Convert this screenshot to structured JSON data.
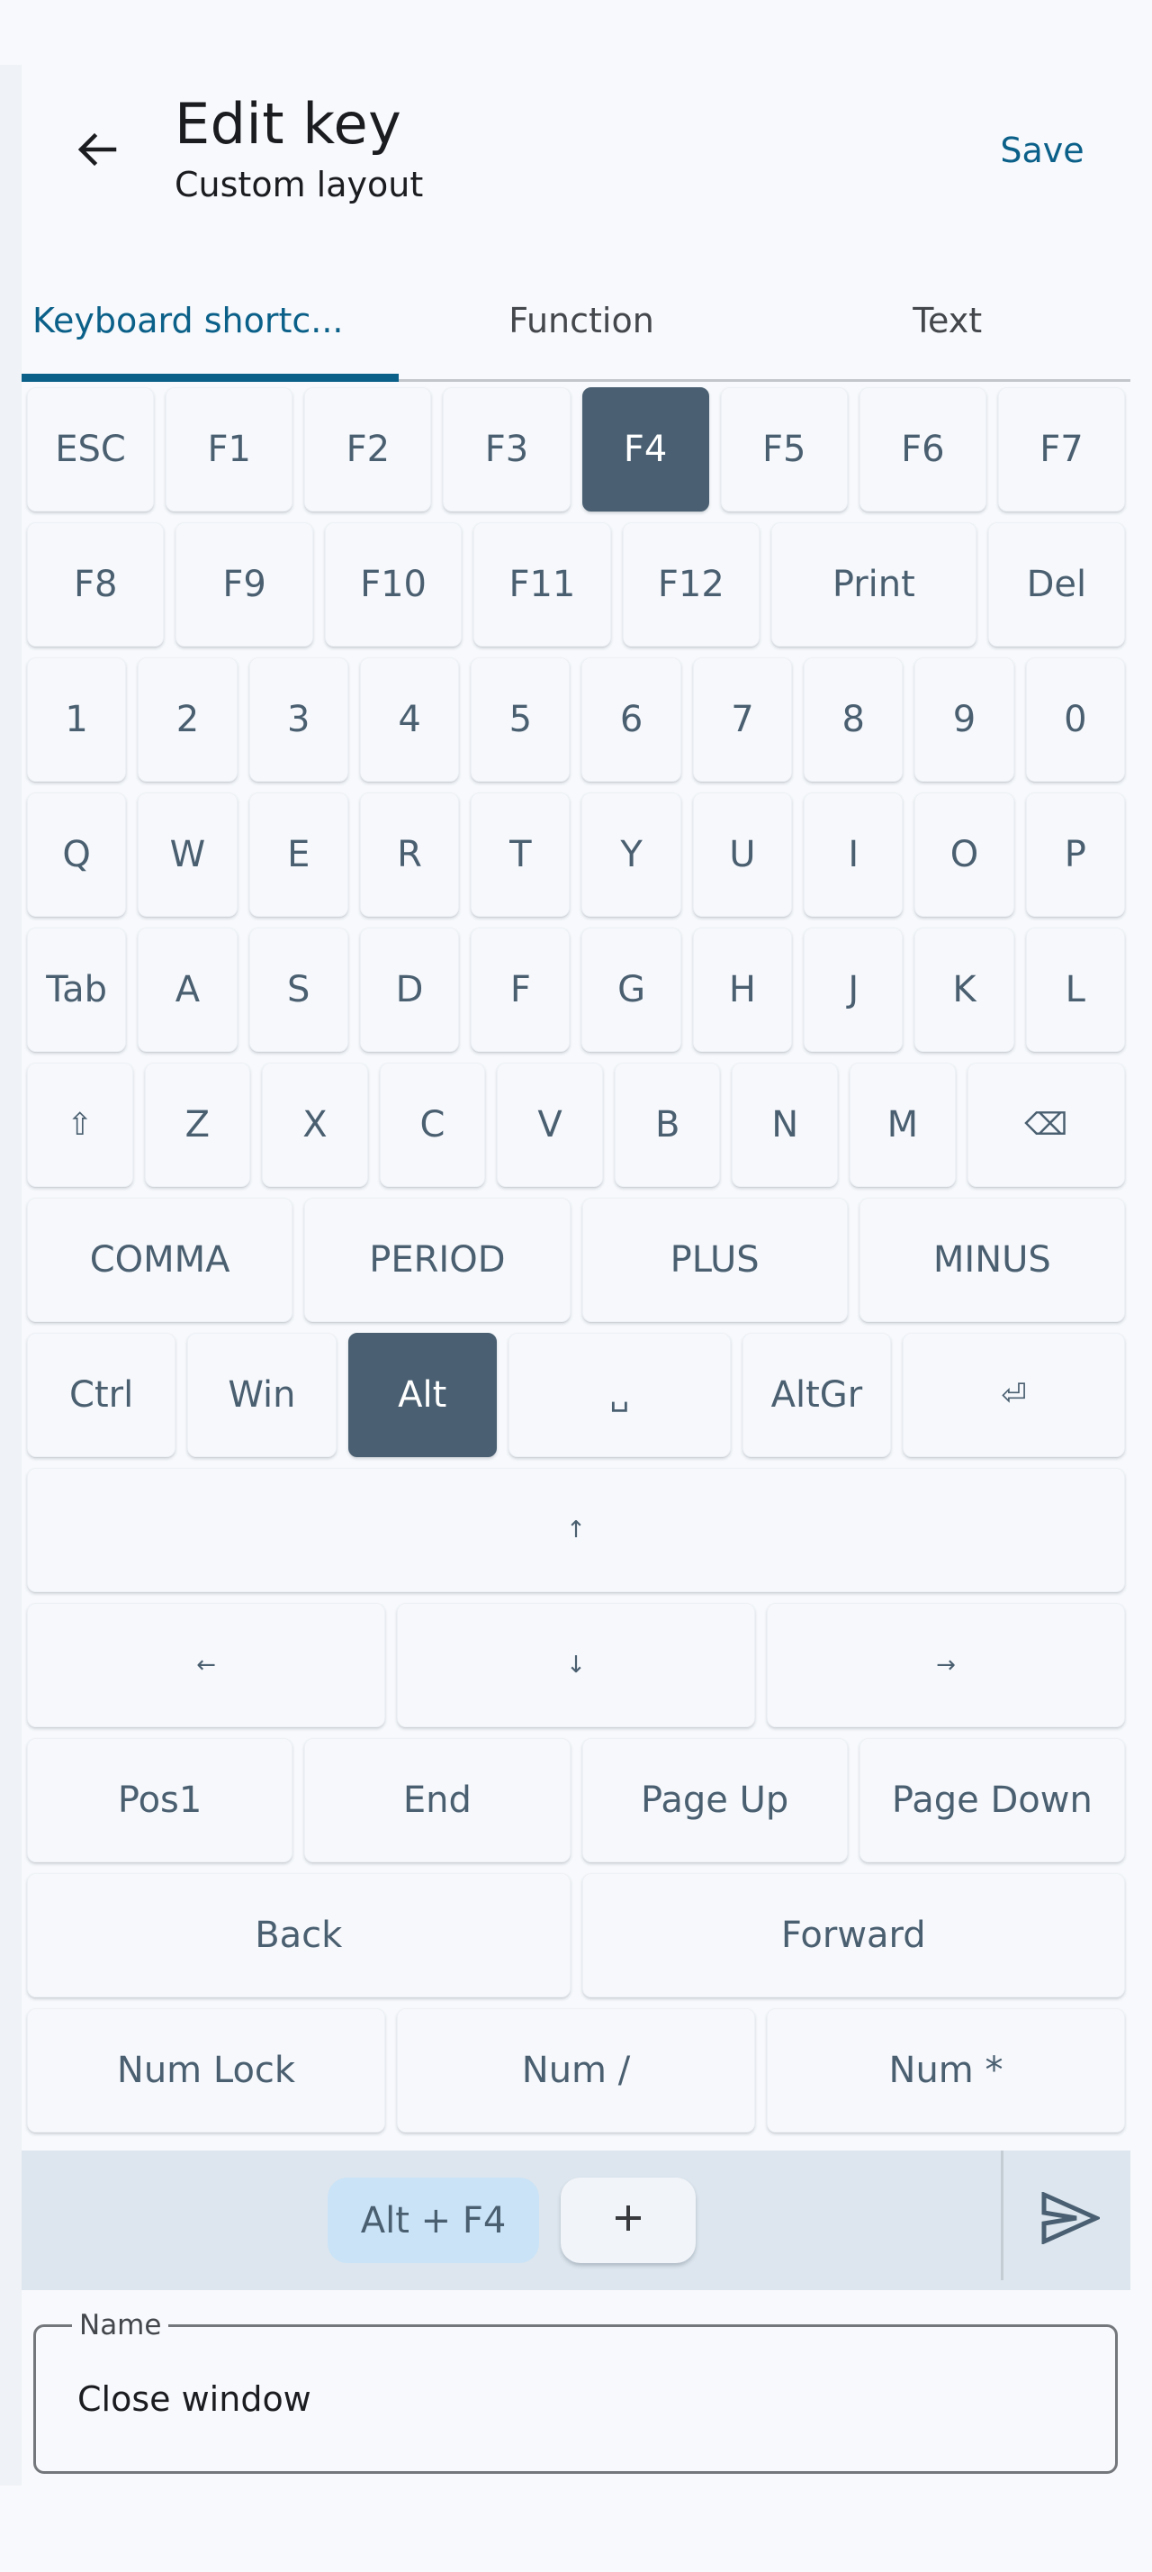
{
  "header": {
    "back_icon": "arrow-left-icon",
    "title": "Edit key",
    "subtitle": "Custom layout",
    "save_label": "Save"
  },
  "tabs": [
    {
      "label": "Keyboard shortc...",
      "active": true
    },
    {
      "label": "Function",
      "active": false
    },
    {
      "label": "Text",
      "active": false
    }
  ],
  "keyboard": {
    "rows": [
      [
        {
          "label": "ESC"
        },
        {
          "label": "F1"
        },
        {
          "label": "F2"
        },
        {
          "label": "F3"
        },
        {
          "label": "F4",
          "selected": true
        },
        {
          "label": "F5"
        },
        {
          "label": "F6"
        },
        {
          "label": "F7"
        }
      ],
      [
        {
          "label": "F8"
        },
        {
          "label": "F9"
        },
        {
          "label": "F10"
        },
        {
          "label": "F11"
        },
        {
          "label": "F12"
        },
        {
          "label": "Print",
          "wide": true
        },
        {
          "label": "Del"
        }
      ],
      [
        {
          "label": "1"
        },
        {
          "label": "2"
        },
        {
          "label": "3"
        },
        {
          "label": "4"
        },
        {
          "label": "5"
        },
        {
          "label": "6"
        },
        {
          "label": "7"
        },
        {
          "label": "8"
        },
        {
          "label": "9"
        },
        {
          "label": "0"
        }
      ],
      [
        {
          "label": "Q"
        },
        {
          "label": "W"
        },
        {
          "label": "E"
        },
        {
          "label": "R"
        },
        {
          "label": "T"
        },
        {
          "label": "Y"
        },
        {
          "label": "U"
        },
        {
          "label": "I"
        },
        {
          "label": "O"
        },
        {
          "label": "P"
        }
      ],
      [
        {
          "label": "Tab"
        },
        {
          "label": "A"
        },
        {
          "label": "S"
        },
        {
          "label": "D"
        },
        {
          "label": "F"
        },
        {
          "label": "G"
        },
        {
          "label": "H"
        },
        {
          "label": "J"
        },
        {
          "label": "K"
        },
        {
          "label": "L"
        }
      ],
      [
        {
          "label": "⇧",
          "icon": "shift-icon"
        },
        {
          "label": "Z"
        },
        {
          "label": "X"
        },
        {
          "label": "C"
        },
        {
          "label": "V"
        },
        {
          "label": "B"
        },
        {
          "label": "N"
        },
        {
          "label": "M"
        },
        {
          "label": "⌫",
          "icon": "backspace-icon",
          "wide": true
        }
      ],
      [
        {
          "label": "COMMA"
        },
        {
          "label": "PERIOD"
        },
        {
          "label": "PLUS"
        },
        {
          "label": "MINUS"
        }
      ],
      [
        {
          "label": "Ctrl"
        },
        {
          "label": "Win"
        },
        {
          "label": "Alt",
          "selected": true
        },
        {
          "label": "␣",
          "icon": "space-icon",
          "wide": true
        },
        {
          "label": "AltGr"
        },
        {
          "label": "⏎",
          "icon": "enter-icon",
          "wide": true
        }
      ],
      [
        {
          "label": "↑",
          "icon": "arrow-up-icon"
        }
      ],
      [
        {
          "label": "←",
          "icon": "arrow-left-icon"
        },
        {
          "label": "↓",
          "icon": "arrow-down-icon"
        },
        {
          "label": "→",
          "icon": "arrow-right-icon"
        }
      ],
      [
        {
          "label": "Pos1"
        },
        {
          "label": "End"
        },
        {
          "label": "Page Up"
        },
        {
          "label": "Page Down"
        }
      ],
      [
        {
          "label": "Back"
        },
        {
          "label": "Forward"
        }
      ],
      [
        {
          "label": "Num Lock"
        },
        {
          "label": "Num /"
        },
        {
          "label": "Num *"
        }
      ]
    ]
  },
  "combo": {
    "chip_label": "Alt + F4",
    "add_label": "+",
    "send_icon": "send-icon"
  },
  "name_field": {
    "label": "Name",
    "value": "Close window"
  },
  "colors": {
    "accent": "#0b6089",
    "selected_key": "#4a6072",
    "key_text": "#4a5f70",
    "chip_bg": "#cae3f7",
    "combo_bar_bg": "#dde6ee"
  }
}
